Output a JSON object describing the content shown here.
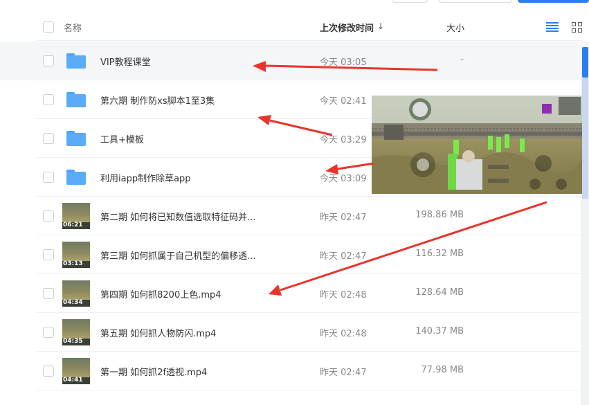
{
  "header": {
    "name_col": "名称",
    "time_col": "上次修改时间",
    "sort_arrow": "↓",
    "size_col": "大小"
  },
  "icons": {
    "folder": "folder-icon",
    "video": "video-thumbnail",
    "list_view": "list-view-icon",
    "grid_view": "grid-view-icon"
  },
  "colors": {
    "accent": "#2a7ef0",
    "folder": "#5aabf8",
    "arrow": "#e8342a"
  },
  "files": [
    {
      "name": "VIP教程课堂",
      "time": "今天 03:05",
      "size": "-",
      "type": "folder"
    },
    {
      "name": "第六期 制作防xs脚本1至3集",
      "time": "今天 02:41",
      "size": "",
      "type": "folder"
    },
    {
      "name": "工具+模板",
      "time": "今天 03:29",
      "size": "",
      "type": "folder"
    },
    {
      "name": "利用iapp制作除草app",
      "time": "今天 03:09",
      "size": "",
      "type": "folder"
    },
    {
      "name": "第二期 如何将已知数值选取特征码并...",
      "time": "昨天 02:47",
      "size": "198.86 MB",
      "type": "video",
      "duration": "06:21"
    },
    {
      "name": "第三期 如何抓属于自己机型的偏移透...",
      "time": "昨天 02:47",
      "size": "116.32 MB",
      "type": "video",
      "duration": "03:13"
    },
    {
      "name": "第四期 如何抓8200上色.mp4",
      "time": "昨天 02:48",
      "size": "128.64 MB",
      "type": "video",
      "duration": "04:34"
    },
    {
      "name": "第五期 如何抓人物防闪.mp4",
      "time": "昨天 02:48",
      "size": "140.37 MB",
      "type": "video",
      "duration": "04:35"
    },
    {
      "name": "第一期 如何抓2f透视.mp4",
      "time": "昨天 02:47",
      "size": "77.98 MB",
      "type": "video",
      "duration": "04:41"
    }
  ]
}
